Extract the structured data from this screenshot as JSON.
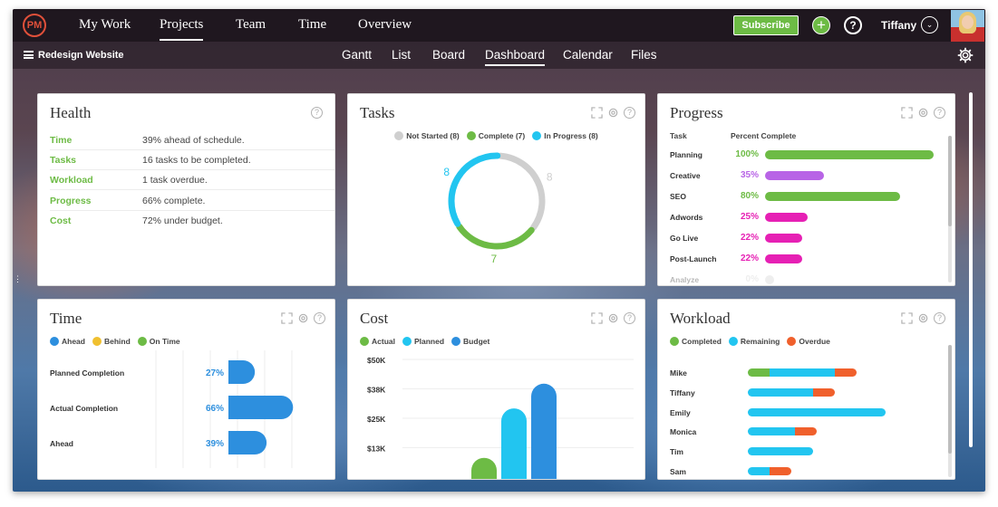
{
  "app": {
    "logo": "PM",
    "project": "Redesign Website",
    "user": "Tiffany",
    "subscribe": "Subscribe"
  },
  "nav": {
    "main": [
      "My Work",
      "Projects",
      "Team",
      "Time",
      "Overview"
    ],
    "active_main": "Projects",
    "sub": [
      "Gantt",
      "List",
      "Board",
      "Dashboard",
      "Calendar",
      "Files"
    ],
    "active_sub": "Dashboard"
  },
  "colors": {
    "green": "#6dbb45",
    "cyan": "#22c5f0",
    "blue": "#2d8fde",
    "gray": "#cfcfcf",
    "purple": "#b864e6",
    "magenta": "#e620b4",
    "orange": "#f0602c",
    "yellow": "#f0c030"
  },
  "health": {
    "title": "Health",
    "rows": [
      {
        "k": "Time",
        "v": "39% ahead of schedule."
      },
      {
        "k": "Tasks",
        "v": "16 tasks to be completed."
      },
      {
        "k": "Workload",
        "v": "1 task overdue."
      },
      {
        "k": "Progress",
        "v": "66% complete."
      },
      {
        "k": "Cost",
        "v": "72% under budget."
      }
    ]
  },
  "tasks": {
    "title": "Tasks",
    "legend": [
      "Not Started (8)",
      "Complete (7)",
      "In Progress (8)"
    ],
    "values": {
      "not_started": 8,
      "complete": 7,
      "in_progress": 8
    }
  },
  "progress": {
    "title": "Progress",
    "col_task": "Task",
    "col_pct": "Percent Complete",
    "rows": [
      {
        "name": "Planning",
        "pct": "100%",
        "value": 1.0,
        "color": "#6dbb45"
      },
      {
        "name": "Creative",
        "pct": "35%",
        "value": 0.35,
        "color": "#b864e6"
      },
      {
        "name": "SEO",
        "pct": "80%",
        "value": 0.8,
        "color": "#6dbb45"
      },
      {
        "name": "Adwords",
        "pct": "25%",
        "value": 0.25,
        "color": "#e620b4"
      },
      {
        "name": "Go Live",
        "pct": "22%",
        "value": 0.22,
        "color": "#e620b4"
      },
      {
        "name": "Post-Launch",
        "pct": "22%",
        "value": 0.22,
        "color": "#e620b4"
      },
      {
        "name": "Analyze",
        "pct": "0%",
        "value": 0,
        "color": "#cfcfcf"
      }
    ]
  },
  "time": {
    "title": "Time",
    "legend": [
      "Ahead",
      "Behind",
      "On Time"
    ],
    "rows": [
      {
        "name": "Planned Completion",
        "pct": "27%",
        "value": 27
      },
      {
        "name": "Actual Completion",
        "pct": "66%",
        "value": 66
      },
      {
        "name": "Ahead",
        "pct": "39%",
        "value": 39
      }
    ]
  },
  "cost": {
    "title": "Cost",
    "legend": [
      "Actual",
      "Planned",
      "Budget"
    ],
    "ticks": [
      "$50K",
      "$38K",
      "$25K",
      "$13K"
    ]
  },
  "workload": {
    "title": "Workload",
    "legend": [
      "Completed",
      "Remaining",
      "Overdue"
    ],
    "rows": [
      {
        "name": "Mike",
        "completed": 3,
        "remaining": 9,
        "overdue": 3
      },
      {
        "name": "Tiffany",
        "completed": 0,
        "remaining": 9,
        "overdue": 3
      },
      {
        "name": "Emily",
        "completed": 0,
        "remaining": 19,
        "overdue": 0
      },
      {
        "name": "Monica",
        "completed": 0,
        "remaining": 6.5,
        "overdue": 3
      },
      {
        "name": "Tim",
        "completed": 0,
        "remaining": 9,
        "overdue": 0
      },
      {
        "name": "Sam",
        "completed": 0,
        "remaining": 3,
        "overdue": 3
      }
    ]
  },
  "chart_data": [
    {
      "type": "pie",
      "title": "Tasks",
      "categories": [
        "Not Started",
        "Complete",
        "In Progress"
      ],
      "values": [
        8,
        7,
        8
      ]
    },
    {
      "type": "bar",
      "title": "Progress",
      "categories": [
        "Planning",
        "Creative",
        "SEO",
        "Adwords",
        "Go Live",
        "Post-Launch",
        "Analyze"
      ],
      "values": [
        100,
        35,
        80,
        25,
        22,
        22,
        0
      ],
      "ylim": [
        0,
        100
      ]
    },
    {
      "type": "bar",
      "title": "Time",
      "categories": [
        "Planned Completion",
        "Actual Completion",
        "Ahead"
      ],
      "values": [
        27,
        66,
        39
      ]
    },
    {
      "type": "bar",
      "title": "Cost",
      "categories": [
        "Actual",
        "Planned",
        "Budget"
      ],
      "values": [
        10,
        30,
        40
      ],
      "ylim": [
        0,
        50
      ],
      "ylabel": ""
    },
    {
      "type": "bar",
      "title": "Workload",
      "categories": [
        "Mike",
        "Tiffany",
        "Emily",
        "Monica",
        "Tim",
        "Sam"
      ],
      "series": [
        {
          "name": "Completed",
          "values": [
            3,
            0,
            0,
            0,
            0,
            0
          ]
        },
        {
          "name": "Remaining",
          "values": [
            9,
            9,
            19,
            6.5,
            9,
            3
          ]
        },
        {
          "name": "Overdue",
          "values": [
            3,
            3,
            0,
            3,
            0,
            3
          ]
        }
      ]
    }
  ]
}
